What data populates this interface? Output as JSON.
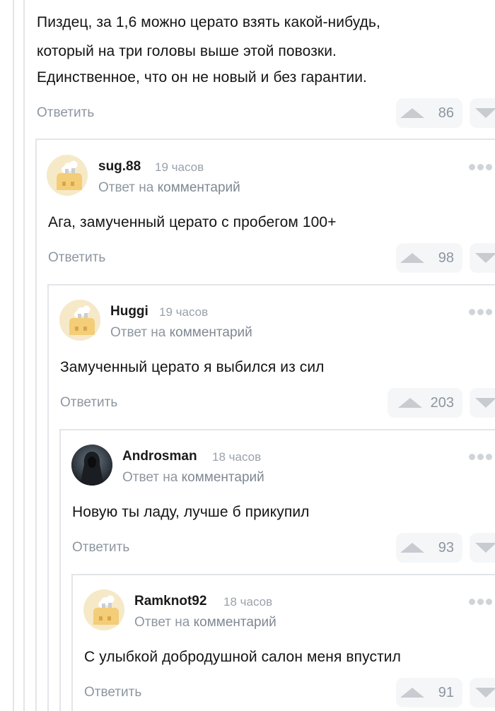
{
  "top_comment": {
    "lines": [
      "Пиздец, за 1,6 можно церато взять какой-нибудь,",
      "который на три головы выше этой повозки.",
      "Единственное, что он не новый и без гарантии."
    ],
    "reply_label": "Ответить",
    "score": "86"
  },
  "comments": [
    {
      "author": "sug.88",
      "time": "19 часов",
      "answer_prefix": "Ответ на",
      "answer_link": "комментарий",
      "text": "Ага, замученный церато с пробегом 100+",
      "reply_label": "Ответить",
      "score": "98",
      "avatar": "pikabu-default-avatar"
    },
    {
      "author": "Huggi",
      "time": "19 часов",
      "answer_prefix": "Ответ на",
      "answer_link": "комментарий",
      "text": "Замученный церато я выбился из сил",
      "reply_label": "Ответить",
      "score": "203",
      "avatar": "pikabu-default-avatar"
    },
    {
      "author": "Androsman",
      "time": "18 часов",
      "answer_prefix": "Ответ на",
      "answer_link": "комментарий",
      "text": "Новую ты ладу, лучше б прикупил",
      "reply_label": "Ответить",
      "score": "93",
      "avatar": "hooded-figure-avatar"
    },
    {
      "author": "Ramknot92",
      "time": "18 часов",
      "answer_prefix": "Ответ на",
      "answer_link": "комментарий",
      "text": "С улыбкой добродушной салон меня впустил",
      "reply_label": "Ответить",
      "score": "91",
      "avatar": "pikabu-default-avatar"
    }
  ]
}
